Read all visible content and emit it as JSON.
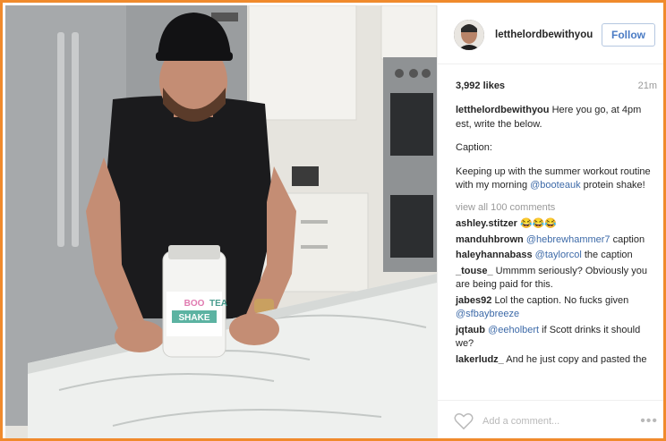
{
  "post": {
    "username": "letthelordbewithyou",
    "follow_label": "Follow",
    "likes": "3,992 likes",
    "time_ago": "21m"
  },
  "caption": {
    "user": "letthelordbewithyou",
    "instruction": "Here you go, at 4pm est, write the below.",
    "caption_label": "Caption:",
    "body_pre": "Keeping up with the summer workout routine with my morning ",
    "body_mention": "@booteauk",
    "body_post": " protein shake!"
  },
  "view_all_label": "view all 100 comments",
  "comments": [
    {
      "user": "ashley.stitzer",
      "pre": "😂😂😂",
      "mention": "",
      "post": ""
    },
    {
      "user": "manduhbrown",
      "pre": "",
      "mention": "@hebrewhammer7",
      "post": " caption"
    },
    {
      "user": "haleyhannabass",
      "pre": "",
      "mention": "@taylorcol",
      "post": " the caption"
    },
    {
      "user": "_touse_",
      "pre": "Ummmm seriously? Obviously you are being paid for this.",
      "mention": "",
      "post": ""
    },
    {
      "user": "jabes92",
      "pre": "Lol the caption. No fucks given ",
      "mention": "@sfbaybreeze",
      "post": ""
    },
    {
      "user": "jqtaub",
      "pre": "",
      "mention": "@eeholbert",
      "post": " if Scott drinks it should we?"
    },
    {
      "user": "lakerludz_",
      "pre": "And he just copy and pasted the",
      "mention": "",
      "post": ""
    }
  ],
  "footer": {
    "add_comment_placeholder": "Add a comment...",
    "more_label": "•••"
  },
  "product": {
    "brand_top": "BOO",
    "brand_top2": "TEA",
    "brand_main": "SHAKE"
  },
  "colors": {
    "accent_border": "#f08a2c",
    "link_blue": "#3d6aa8",
    "follow_blue": "#4a7bc4"
  }
}
